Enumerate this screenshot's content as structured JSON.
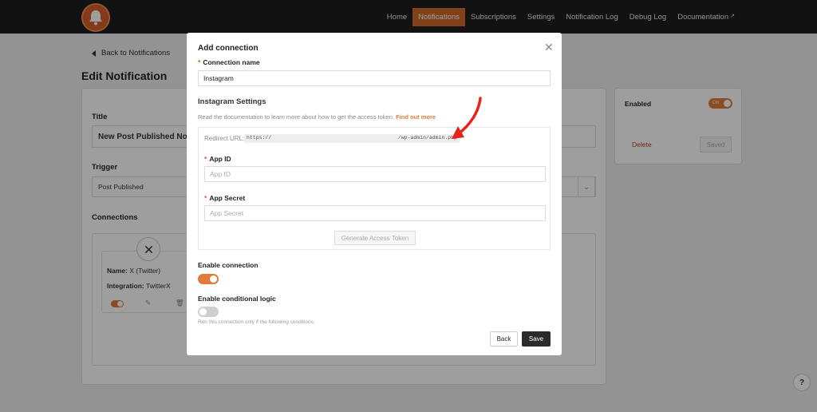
{
  "nav": {
    "items": [
      "Home",
      "Notifications",
      "Subscriptions",
      "Settings",
      "Notification Log",
      "Debug Log",
      "Documentation"
    ],
    "active_index": 1
  },
  "page": {
    "back_link": "Back to Notifications",
    "title": "Edit Notification",
    "title_label": "Title",
    "title_value": "New Post Published Notifi",
    "trigger_label": "Trigger",
    "trigger_value": "Post Published",
    "connections_label": "Connections",
    "connection_card": {
      "name_label": "Name:",
      "name_value": "X (Twitter)",
      "integration_label": "Integration:",
      "integration_value": "TwitterX"
    }
  },
  "sidebar": {
    "enabled_label": "Enabled",
    "toggle_text": "On",
    "delete_label": "Delete",
    "saved_label": "Saved"
  },
  "modal": {
    "title": "Add connection",
    "connection_name_label": "Connection name",
    "connection_name_value": "Instagram",
    "section_title": "Instagram Settings",
    "description": "Read the documentation to learn more about how to get the access token.",
    "find_out_more": "Find out more",
    "redirect_label": "Redirect URL:",
    "redirect_prefix": "https://",
    "redirect_suffix": "/wp-admin/admin.php",
    "app_id_label": "App ID",
    "app_id_placeholder": "App ID",
    "app_secret_label": "App Secret",
    "app_secret_placeholder": "App Secret",
    "generate_button": "Generate Access Token",
    "enable_connection_label": "Enable connection",
    "enable_connection_on": true,
    "conditional_logic_label": "Enable conditional logic",
    "conditional_logic_on": false,
    "conditional_hint": "Run this connection only if the following conditions:",
    "back_button": "Back",
    "save_button": "Save"
  },
  "colors": {
    "accent": "#e07b39",
    "nav_bg": "#1d1d1d",
    "arrow": "#e8221c"
  },
  "help_icon": "?"
}
